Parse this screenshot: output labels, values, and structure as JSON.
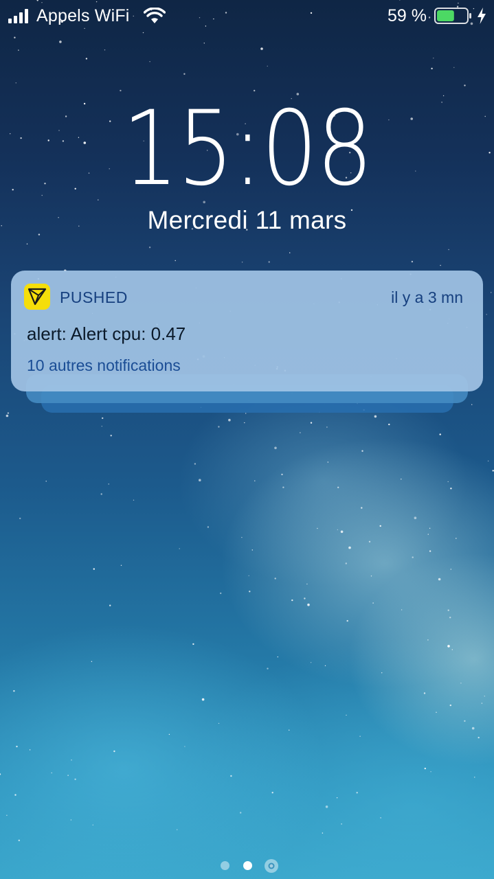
{
  "status_bar": {
    "carrier": "Appels WiFi",
    "battery_percent": "59 %",
    "battery_level": 0.59,
    "icons": [
      "signal-icon",
      "wifi-icon",
      "battery-icon",
      "charging-bolt-icon"
    ]
  },
  "lock_screen": {
    "time": "15:08",
    "date": "Mercredi 11 mars"
  },
  "notification": {
    "app_name": "PUSHED",
    "app_icon": "pushed-app-icon",
    "app_icon_color": "#f5de0a",
    "time_ago": "il y a 3 mn",
    "body": "alert: Alert cpu: 0.47",
    "more": "10 autres notifications"
  },
  "page_indicator": {
    "pages": 2,
    "current_page": 2,
    "extra": "camera-icon"
  }
}
